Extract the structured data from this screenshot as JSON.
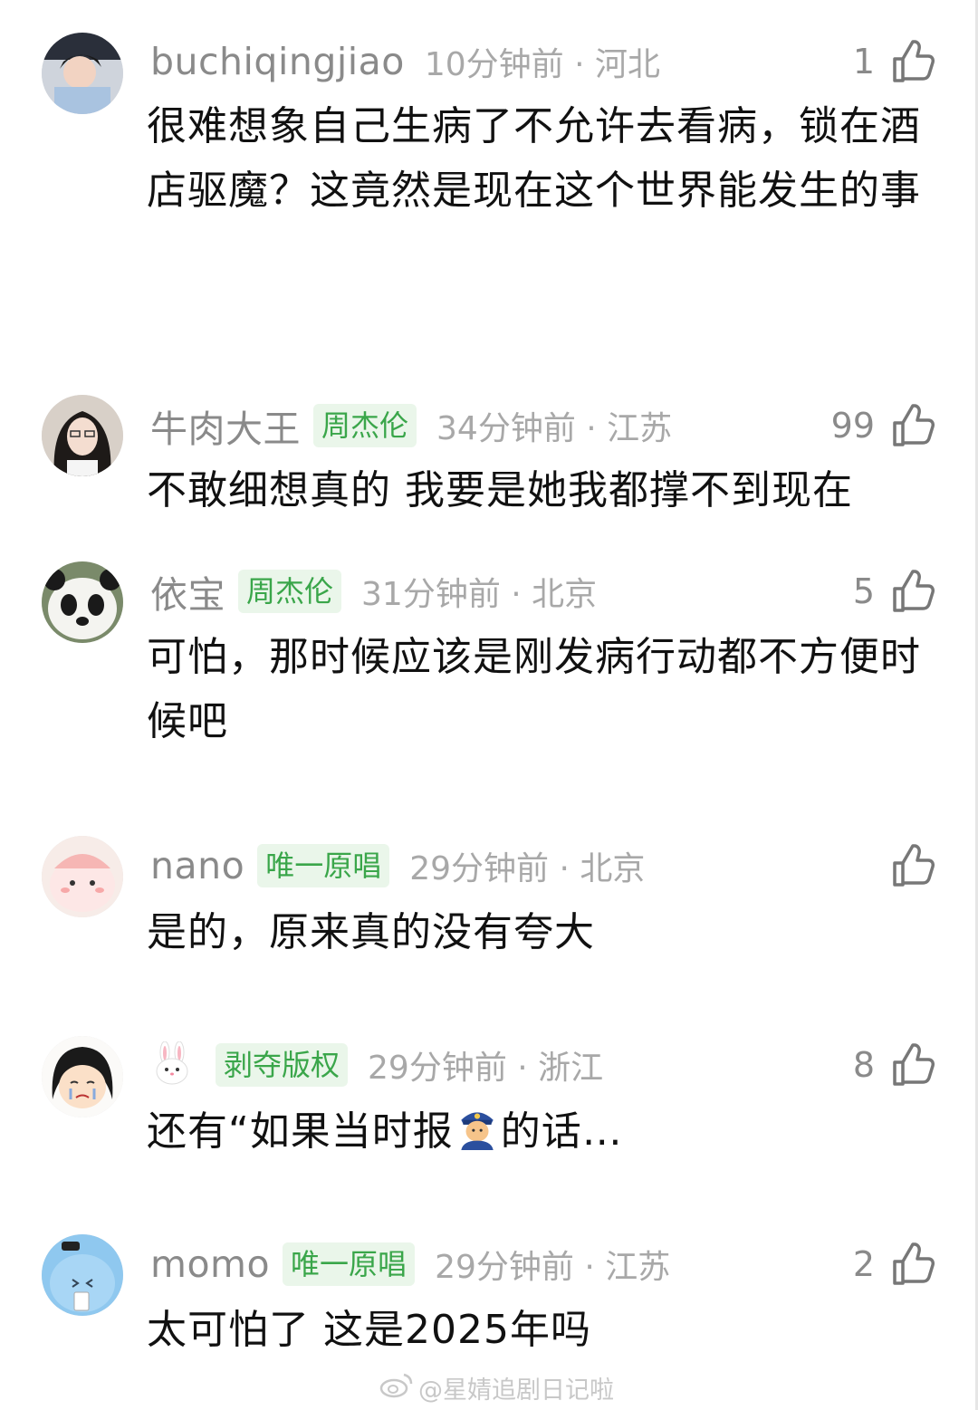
{
  "comments": [
    {
      "username": "buchiqingjiao",
      "badge": "",
      "time_location": "10分钟前 · 河北",
      "likes": "1",
      "text": "很难想象自己生病了不允许去看病，锁在酒店驱魔？这竟然是现在这个世界能发生的事"
    },
    {
      "username": "牛肉大王",
      "badge": "周杰伦",
      "time_location": "34分钟前 · 江苏",
      "likes": "99",
      "text": "不敢细想真的 我要是她我都撑不到现在"
    },
    {
      "username": "依宝",
      "badge": "周杰伦",
      "time_location": "31分钟前 · 北京",
      "likes": "5",
      "text": "可怕，那时候应该是刚发病行动都不方便时候吧"
    },
    {
      "username": "nano",
      "badge": "唯一原唱",
      "time_location": "29分钟前 · 北京",
      "likes": "",
      "text": "是的，原来真的没有夸大"
    },
    {
      "username": "",
      "badge": "剥夺版权",
      "time_location": "29分钟前 · 浙江",
      "likes": "8",
      "text_before": "还有“如果当时报",
      "text_after": "的话…"
    },
    {
      "username": "momo",
      "badge": "唯一原唱",
      "time_location": "29分钟前 · 江苏",
      "likes": "2",
      "text": "太可怕了 这是2025年吗"
    }
  ],
  "icons": {
    "like": "thumbs-up-icon",
    "police": "police-officer-emoji",
    "rabbit": "rabbit-emoji",
    "weibo": "weibo-logo-icon"
  },
  "watermark": "@星婧追剧日记啦",
  "colors": {
    "badge_bg": "#eaf6ea",
    "badge_text": "#3aa64a",
    "meta_text": "#a8a8a8"
  }
}
